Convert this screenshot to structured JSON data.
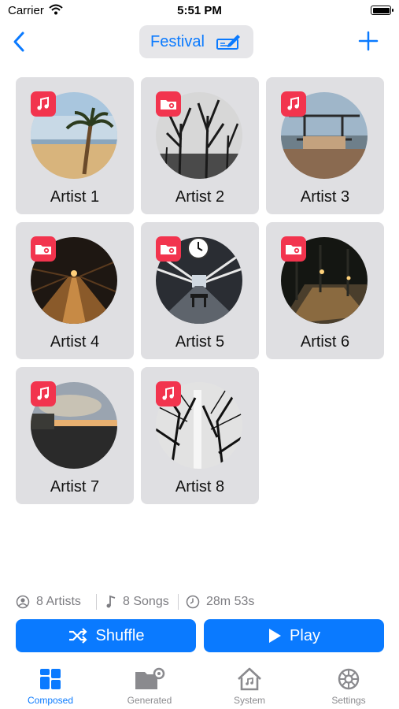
{
  "status_bar": {
    "carrier": "Carrier",
    "time": "5:51 PM"
  },
  "nav": {
    "title": "Festival",
    "back_icon": "chevron-left-icon",
    "edit_icon": "pencil-square-icon",
    "add_icon": "plus-icon"
  },
  "artists": [
    {
      "name": "Artist 1",
      "badge": "music-note-icon"
    },
    {
      "name": "Artist 2",
      "badge": "folder-gear-icon"
    },
    {
      "name": "Artist 3",
      "badge": "music-note-icon"
    },
    {
      "name": "Artist 4",
      "badge": "folder-gear-icon"
    },
    {
      "name": "Artist 5",
      "badge": "folder-gear-icon"
    },
    {
      "name": "Artist 6",
      "badge": "folder-gear-icon"
    },
    {
      "name": "Artist 7",
      "badge": "music-note-icon"
    },
    {
      "name": "Artist 8",
      "badge": "music-note-icon"
    }
  ],
  "stats": {
    "artists": "8 Artists",
    "songs": "8 Songs",
    "duration": "28m 53s"
  },
  "buttons": {
    "shuffle": "Shuffle",
    "play": "Play"
  },
  "tabs": [
    {
      "label": "Composed",
      "icon": "grid-icon",
      "active": true
    },
    {
      "label": "Generated",
      "icon": "folder-gear-icon",
      "active": false
    },
    {
      "label": "System",
      "icon": "house-icon",
      "active": false
    },
    {
      "label": "Settings",
      "icon": "gear-icon",
      "active": false
    }
  ],
  "colors": {
    "accent": "#0a7aff",
    "badge": "#f2344e",
    "card": "#dfdfe2"
  }
}
